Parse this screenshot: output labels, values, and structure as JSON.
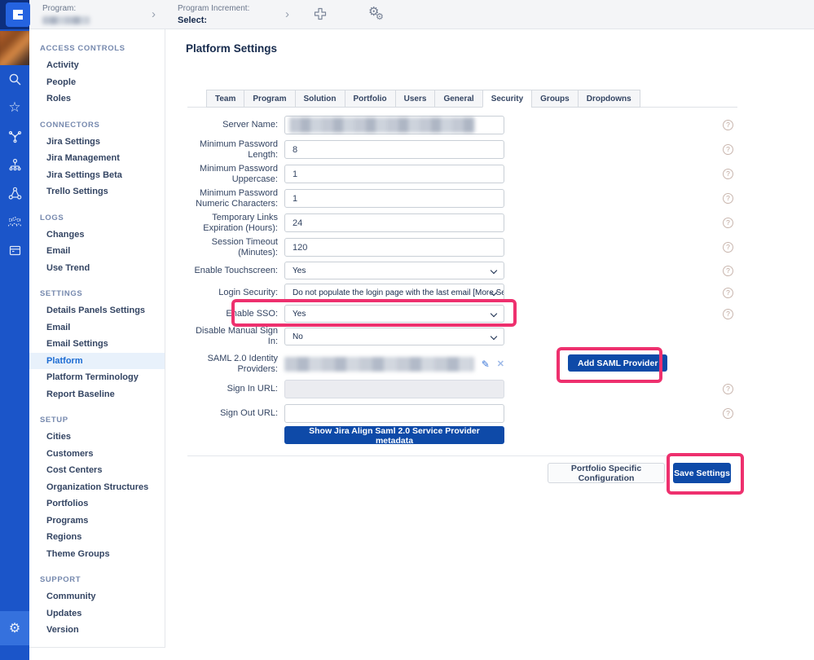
{
  "topbar": {
    "program_label": "Program:",
    "program_increment_label": "Program Increment:",
    "select_label": "Select:",
    "icons": [
      "plus-icon",
      "gears-icon"
    ]
  },
  "rail_icons": [
    "search",
    "star",
    "connections",
    "hierarchy",
    "network",
    "people",
    "board"
  ],
  "rail_bottom_icon": "settings-gear",
  "sidebar": {
    "sections": [
      {
        "header": "ACCESS CONTROLS",
        "items": [
          "Activity",
          "People",
          "Roles"
        ]
      },
      {
        "header": "CONNECTORS",
        "items": [
          "Jira Settings",
          "Jira Management",
          "Jira Settings Beta",
          "Trello Settings"
        ]
      },
      {
        "header": "LOGS",
        "items": [
          "Changes",
          "Email",
          "Use Trend"
        ]
      },
      {
        "header": "SETTINGS",
        "items": [
          "Details Panels Settings",
          "Email",
          "Email Settings",
          "Platform",
          "Platform Terminology",
          "Report Baseline"
        ]
      },
      {
        "header": "SETUP",
        "items": [
          "Cities",
          "Customers",
          "Cost Centers",
          "Organization Structures",
          "Portfolios",
          "Programs",
          "Regions",
          "Theme Groups"
        ]
      },
      {
        "header": "SUPPORT",
        "items": [
          "Community",
          "Updates",
          "Version"
        ]
      }
    ],
    "active_item": "Platform"
  },
  "header": {
    "title_primary": "Platform",
    "title_secondary": "Settings"
  },
  "tabs": {
    "items": [
      "Team",
      "Program",
      "Solution",
      "Portfolio",
      "Users",
      "General",
      "Security",
      "Groups",
      "Dropdowns"
    ],
    "active": "Security"
  },
  "form": {
    "rows": [
      {
        "label": "Server Name:",
        "control": "input-blurred",
        "value": "",
        "help": true
      },
      {
        "label": "Minimum Password Length:",
        "control": "input",
        "value": "8",
        "help": true
      },
      {
        "label": "Minimum Password Uppercase:",
        "control": "input",
        "value": "1",
        "help": true
      },
      {
        "label": "Minimum Password Numeric Characters:",
        "control": "input",
        "value": "1",
        "help": true
      },
      {
        "label": "Temporary Links Expiration (Hours):",
        "control": "input",
        "value": "24",
        "help": true
      },
      {
        "label": "Session Timeout (Minutes):",
        "control": "input",
        "value": "120",
        "help": true
      },
      {
        "label": "Enable Touchscreen:",
        "control": "select",
        "value": "Yes",
        "help": true
      },
      {
        "label": "Login Security:",
        "control": "select",
        "value": "Do not populate the login page with the last email [More Secure]",
        "help": true
      },
      {
        "label": "Enable SSO:",
        "control": "select",
        "value": "Yes",
        "help": true,
        "highlight": true
      },
      {
        "label": "Disable Manual Sign In:",
        "control": "select",
        "value": "No",
        "help": false
      },
      {
        "label": "SAML 2.0 Identity Providers:",
        "control": "blurred-text",
        "value": "",
        "help": false,
        "icons": [
          "edit-icon",
          "delete-icon"
        ]
      },
      {
        "label": "Sign In URL:",
        "control": "input-disabled",
        "value": "",
        "help": true
      },
      {
        "label": "Sign Out URL:",
        "control": "input",
        "value": "",
        "help": true
      },
      {
        "label": "",
        "control": "button",
        "value": "Show Jira Align Saml 2.0 Service Provider metadata",
        "help": false
      }
    ],
    "add_saml_button": "Add SAML Provider"
  },
  "footer": {
    "portfolio_button": "Portfolio Specific Configuration",
    "save_button": "Save Settings"
  },
  "colors": {
    "rail_blue": "#1b55c9",
    "primary_button_blue": "#0e4aa8",
    "highlight_pink": "#ee306e",
    "active_item_blue": "#1c6cd3"
  }
}
